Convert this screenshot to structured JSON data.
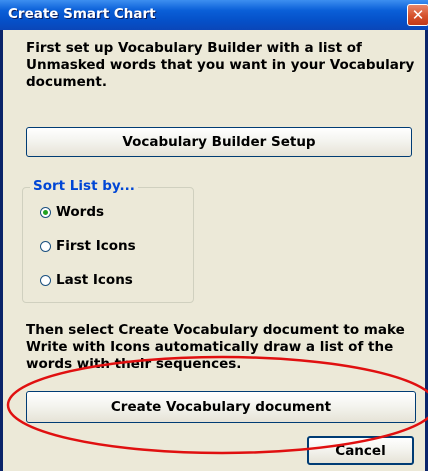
{
  "window": {
    "title": "Create Smart Chart",
    "close_glyph": "✕"
  },
  "intro_text": "First set up Vocabulary Builder with a list of Unmasked words that you want in your Vocabulary document.",
  "buttons": {
    "setup": "Vocabulary Builder Setup",
    "create": "Create Vocabulary document",
    "cancel": "Cancel"
  },
  "sort_group": {
    "label": "Sort List by...",
    "options": [
      {
        "label": "Words",
        "checked": true
      },
      {
        "label": "First Icons",
        "checked": false
      },
      {
        "label": "Last Icons",
        "checked": false
      }
    ]
  },
  "instruction_text": "Then select Create Vocabulary document to make Write with Icons automatically draw a list of the words with their sequences.",
  "colors": {
    "titlebar": "#0550c8",
    "dialog_bg": "#ece9d8",
    "group_label": "#0046d5",
    "annotation_ellipse": "#e01010",
    "radio_dot": "#21a121"
  }
}
